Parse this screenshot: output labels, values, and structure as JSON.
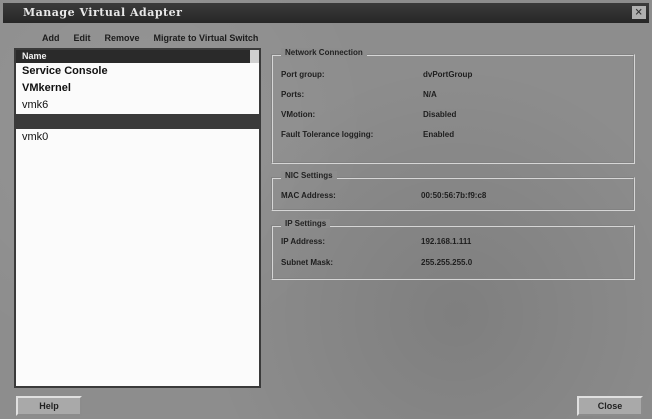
{
  "window": {
    "title": "Manage Virtual Adapter",
    "close_glyph": "×"
  },
  "toolbar": {
    "items": [
      "Add",
      "Edit",
      "Remove",
      "Migrate to Virtual Switch"
    ]
  },
  "adapter_list": {
    "header": "Name",
    "items": [
      {
        "label": "Service Console",
        "bold": true
      },
      {
        "label": "VMkernel",
        "bold": true
      },
      {
        "label": "vmk6",
        "bold": false
      },
      {
        "label": "",
        "bold": false,
        "selected": true
      },
      {
        "label": "vmk0",
        "bold": false
      }
    ]
  },
  "network_connection": {
    "title": "Network Connection",
    "rows": [
      {
        "key": "Port group:",
        "value": "dvPortGroup"
      },
      {
        "key": "Ports:",
        "value": "N/A"
      },
      {
        "key": "VMotion:",
        "value": "Disabled"
      },
      {
        "key": "Fault Tolerance logging:",
        "value": "Enabled"
      }
    ]
  },
  "nic_settings": {
    "title": "NIC Settings",
    "rows": [
      {
        "key": "MAC Address:",
        "value": "00:50:56:7b:f9:c8"
      }
    ]
  },
  "ip_settings": {
    "title": "IP Settings",
    "rows": [
      {
        "key": "IP Address:",
        "value": "192.168.1.111"
      },
      {
        "key": "Subnet Mask:",
        "value": "255.255.255.0"
      }
    ]
  },
  "buttons": {
    "help": "Help",
    "close": "Close"
  }
}
